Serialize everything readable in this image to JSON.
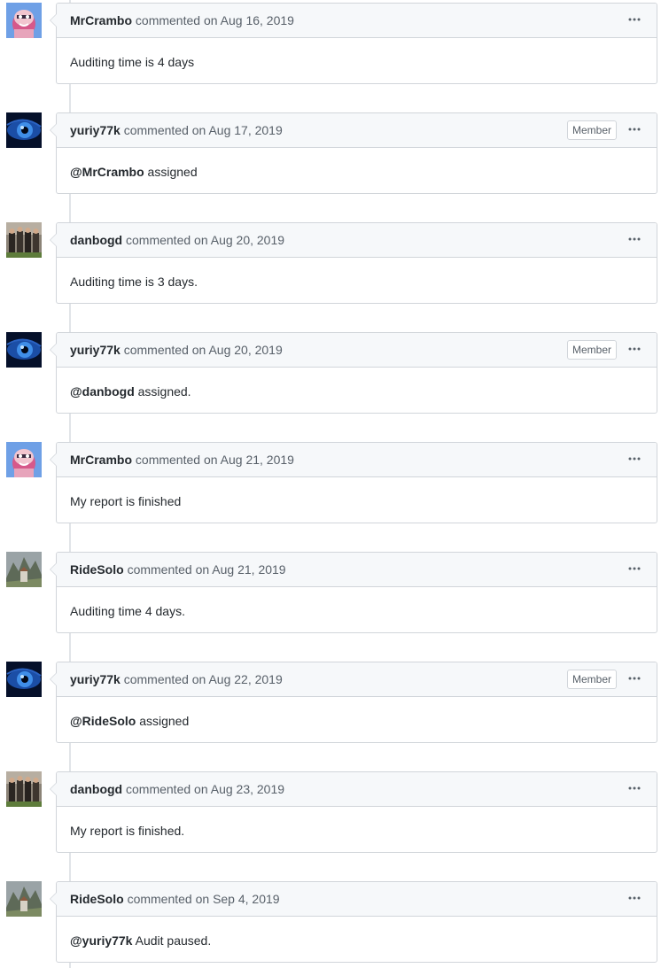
{
  "comments": [
    {
      "author": "MrCrambo",
      "action": "commented on",
      "date": "Aug 16, 2019",
      "badge": "",
      "mention": "",
      "body": "Auditing time is 4 days",
      "avatar": "mrcrambo"
    },
    {
      "author": "yuriy77k",
      "action": "commented on",
      "date": "Aug 17, 2019",
      "badge": "Member",
      "mention": "@MrCrambo",
      "body": " assigned",
      "avatar": "yuriy77k"
    },
    {
      "author": "danbogd",
      "action": "commented on",
      "date": "Aug 20, 2019",
      "badge": "",
      "mention": "",
      "body": "Auditing time is 3 days.",
      "avatar": "danbogd"
    },
    {
      "author": "yuriy77k",
      "action": "commented on",
      "date": "Aug 20, 2019",
      "badge": "Member",
      "mention": "@danbogd",
      "body": " assigned.",
      "avatar": "yuriy77k"
    },
    {
      "author": "MrCrambo",
      "action": "commented on",
      "date": "Aug 21, 2019",
      "badge": "",
      "mention": "",
      "body": "My report is finished",
      "avatar": "mrcrambo"
    },
    {
      "author": "RideSolo",
      "action": "commented on",
      "date": "Aug 21, 2019",
      "badge": "",
      "mention": "",
      "body": "Auditing time 4 days.",
      "avatar": "ridesolo"
    },
    {
      "author": "yuriy77k",
      "action": "commented on",
      "date": "Aug 22, 2019",
      "badge": "Member",
      "mention": "@RideSolo",
      "body": " assigned",
      "avatar": "yuriy77k"
    },
    {
      "author": "danbogd",
      "action": "commented on",
      "date": "Aug 23, 2019",
      "badge": "",
      "mention": "",
      "body": "My report is finished.",
      "avatar": "danbogd"
    },
    {
      "author": "RideSolo",
      "action": "commented on",
      "date": "Sep 4, 2019",
      "badge": "",
      "mention": "",
      "body": "@yuriy77k Audit paused.",
      "avatar": "ridesolo",
      "split_mention": "@yuriy77k",
      "rest": " Audit paused."
    }
  ]
}
